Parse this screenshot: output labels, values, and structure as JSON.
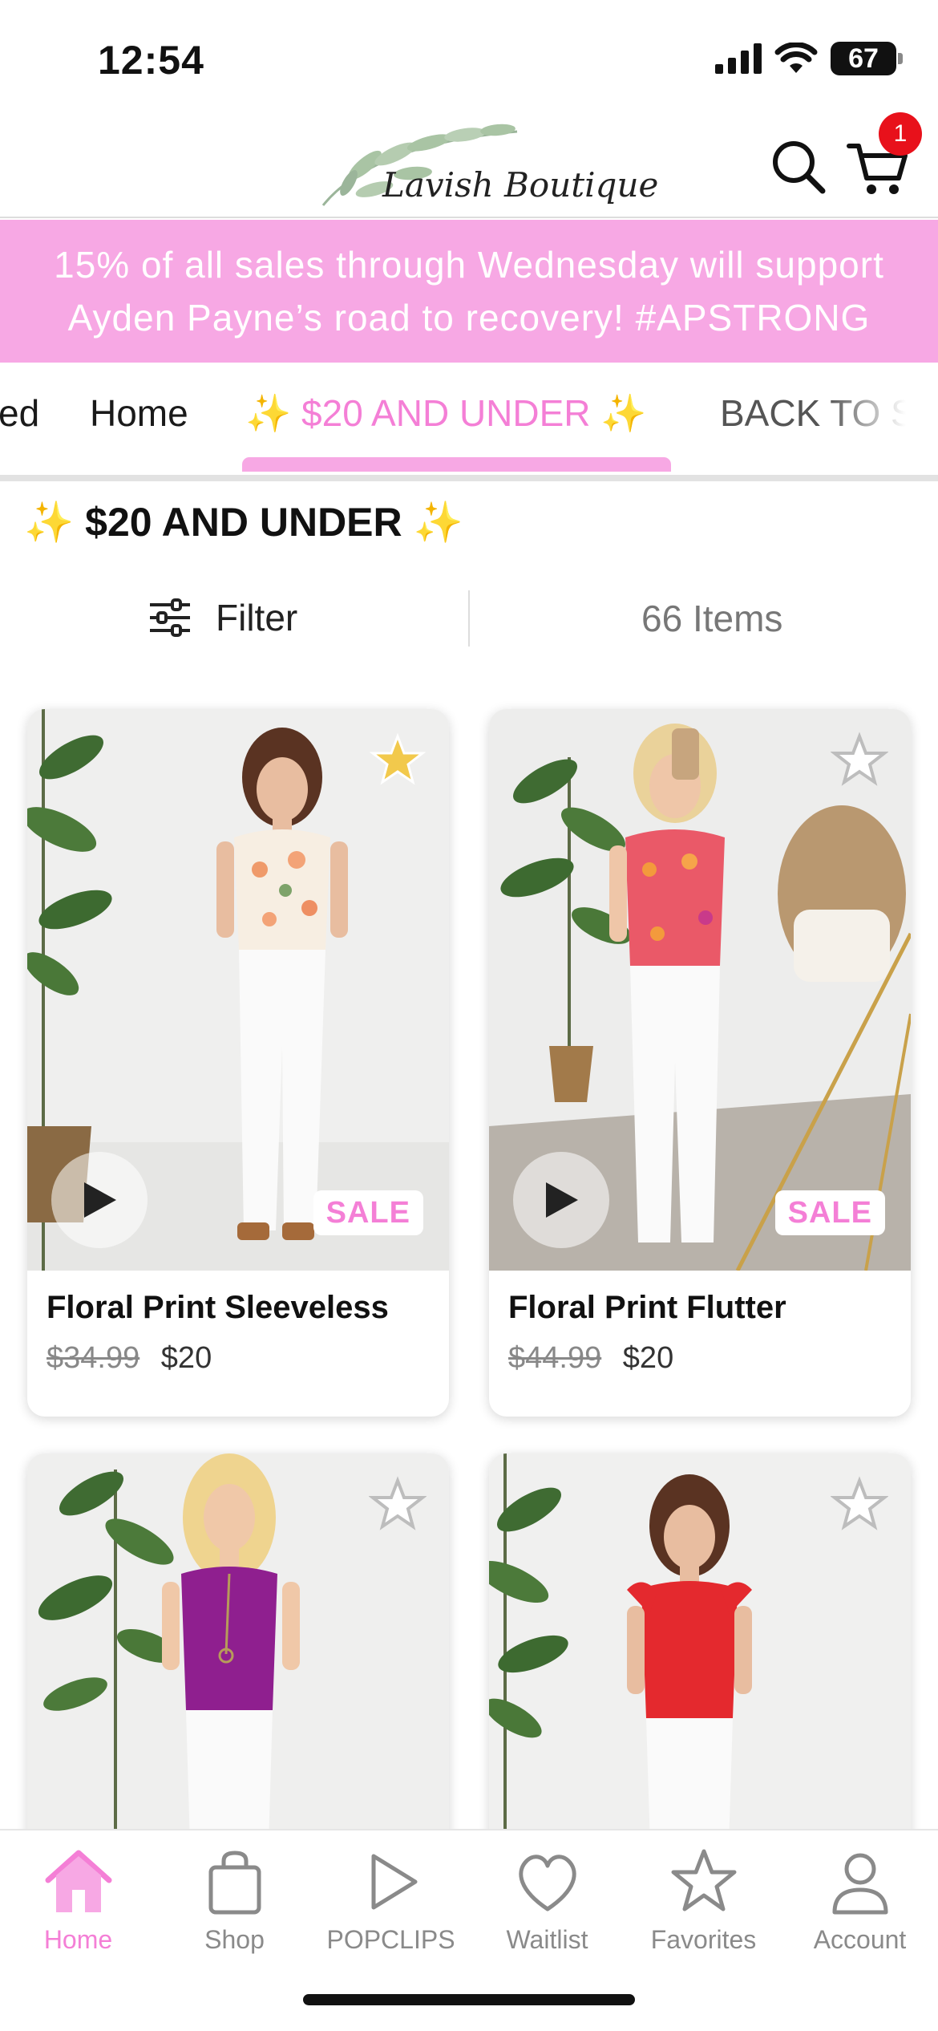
{
  "status_bar": {
    "time": "12:54",
    "battery": "67",
    "icons": [
      "signal-icon",
      "wifi-icon",
      "battery-icon"
    ]
  },
  "header": {
    "brand": "Lavish Boutique",
    "cart_count": "1",
    "icons": [
      "leaf-logo-icon",
      "search-icon",
      "cart-icon"
    ]
  },
  "promo": {
    "text": "15% of all sales through Wednesday will support Ayden Payne’s road to recovery! #APSTRONG"
  },
  "categories": {
    "tabs": [
      {
        "label": "ed"
      },
      {
        "label": "Home"
      },
      {
        "label": "✨ $20 AND UNDER ✨"
      },
      {
        "label": "BACK TO S"
      }
    ],
    "active_index": 2
  },
  "section": {
    "title": "$20 AND UNDER",
    "sparkle": "✨"
  },
  "filter": {
    "label": "Filter",
    "items_count": "66 Items"
  },
  "products": [
    {
      "name": "Floral Print Sleeveless",
      "original_price": "$34.99",
      "price": "$20",
      "sale_badge": "SALE",
      "favorited": true,
      "has_video": true
    },
    {
      "name": "Floral Print Flutter",
      "original_price": "$44.99",
      "price": "$20",
      "sale_badge": "SALE",
      "favorited": false,
      "has_video": true
    },
    {
      "name": "",
      "original_price": "",
      "price": "",
      "sale_badge": "",
      "favorited": false,
      "has_video": false
    },
    {
      "name": "",
      "original_price": "",
      "price": "",
      "sale_badge": "",
      "favorited": false,
      "has_video": false
    }
  ],
  "bottom_nav": {
    "items": [
      {
        "label": "Home",
        "icon": "home-icon",
        "active": true
      },
      {
        "label": "Shop",
        "icon": "shopping-bag-icon",
        "active": false
      },
      {
        "label": "POPCLIPS",
        "icon": "play-icon",
        "active": false
      },
      {
        "label": "Waitlist",
        "icon": "heart-icon",
        "active": false
      },
      {
        "label": "Favorites",
        "icon": "star-icon",
        "active": false
      },
      {
        "label": "Account",
        "icon": "person-icon",
        "active": false
      }
    ]
  },
  "colors": {
    "accent_pink": "#f47fd6",
    "banner_pink": "#f7a8e4",
    "badge_red": "#e8111b",
    "star_gold": "#f2c94c"
  }
}
